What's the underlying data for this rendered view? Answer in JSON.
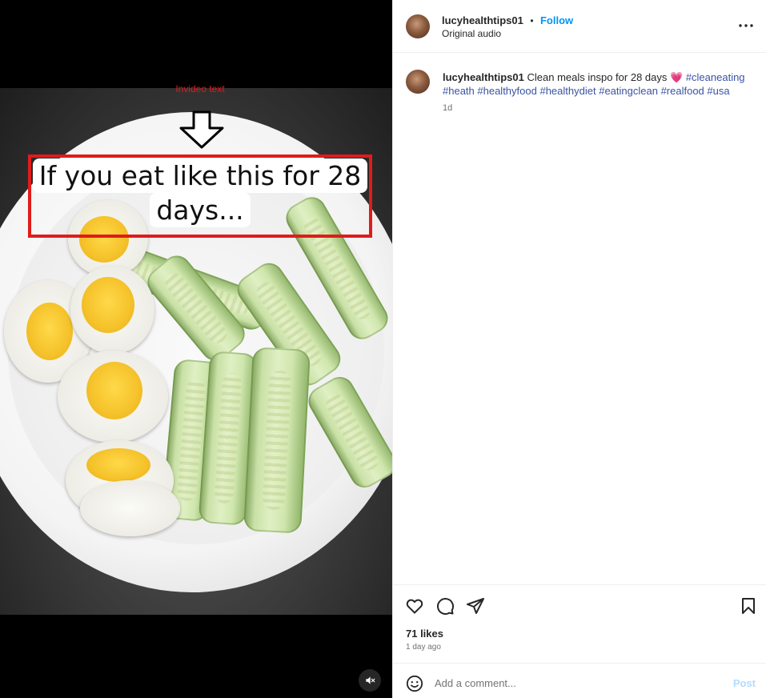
{
  "media": {
    "annotation_label": "Invideo text",
    "overlay_line1": "If you eat like this for 28",
    "overlay_line2": "days...",
    "mute_icon": "muted-speaker-icon"
  },
  "post": {
    "username": "lucyhealthtips01",
    "separator": "•",
    "follow_label": "Follow",
    "audio_label": "Original audio",
    "more_icon": "more-options-icon",
    "caption_username": "lucyhealthtips01",
    "caption_text": "Clean meals inspo for 28 days",
    "caption_emoji": "💗",
    "hashtags": [
      "#cleaneating",
      "#heath",
      "#healthyfood",
      "#healthydiet",
      "#eatingclean",
      "#realfood",
      "#usa"
    ],
    "caption_time": "1d",
    "likes": "71 likes",
    "posted_ago": "1 day ago"
  },
  "comment": {
    "placeholder": "Add a comment...",
    "post_label": "Post"
  },
  "colors": {
    "link": "#0095f6",
    "hashtag": "#3a53a4",
    "annotation": "#e11b1b"
  }
}
